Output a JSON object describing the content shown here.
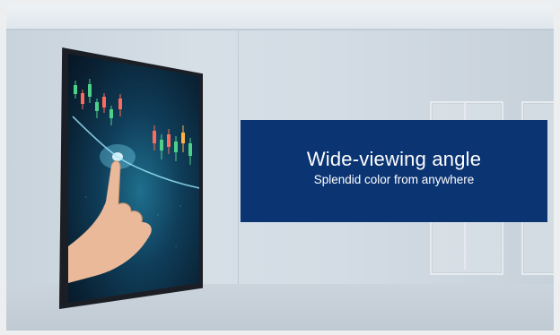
{
  "banner": {
    "title": "Wide-viewing angle",
    "subtitle": "Splendid color from anywhere",
    "background_color": "#0b3473",
    "text_color": "#ffffff"
  },
  "display_content": {
    "screen_icon": "stock-chart-with-hand-icon",
    "screen_accent_color": "#1e6f8d"
  }
}
